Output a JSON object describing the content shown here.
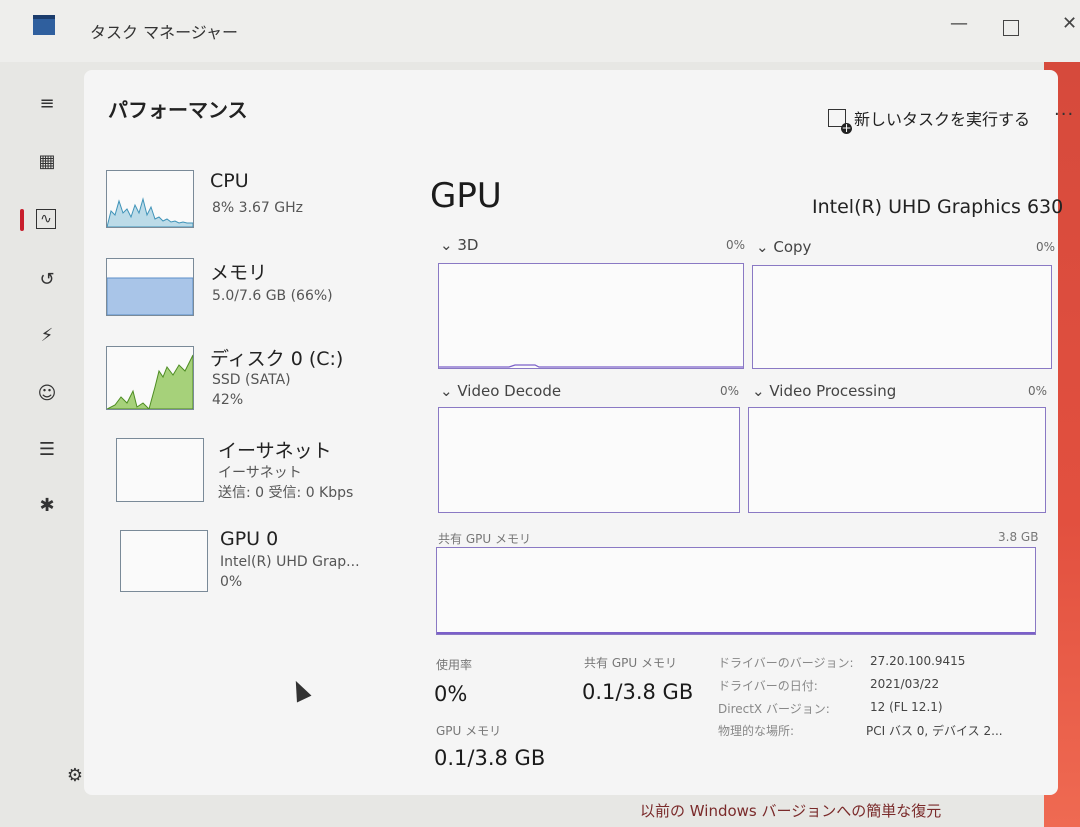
{
  "window": {
    "title": "タスク マネージャー",
    "min": "—",
    "close": "✕"
  },
  "nav": {
    "menu_icon": "≡",
    "items": [
      {
        "name": "processes",
        "icon": "▦"
      },
      {
        "name": "performance",
        "icon": "∿"
      },
      {
        "name": "app-history",
        "icon": "↺"
      },
      {
        "name": "startup-apps",
        "icon": "⚡"
      },
      {
        "name": "users",
        "icon": "☺"
      },
      {
        "name": "details",
        "icon": "☰"
      },
      {
        "name": "services",
        "icon": "✱"
      }
    ],
    "settings_icon": "⚙"
  },
  "header": {
    "title": "パフォーマンス",
    "run_task": "新しいタスクを実行する",
    "more": "···"
  },
  "devices": [
    {
      "name": "CPU",
      "sub1": "8%  3.67 GHz",
      "sub2": "",
      "color": "#3f93b8"
    },
    {
      "name": "メモリ",
      "sub1": "5.0/7.6 GB (66%)",
      "sub2": "",
      "memory_fraction": 0.66,
      "color": "#5c8ec9"
    },
    {
      "name": "ディスク 0 (C:)",
      "sub1": "SSD (SATA)",
      "sub2": "42%",
      "color": "#6fb43a"
    },
    {
      "name": "イーサネット",
      "sub1": "イーサネット",
      "sub2": "送信: 0  受信: 0 Kbps",
      "color": "#a36fb0"
    },
    {
      "name": "GPU 0",
      "sub1": "Intel(R) UHD Grap...",
      "sub2": "0%",
      "color": "#7b5fc9"
    }
  ],
  "gpu": {
    "title": "GPU",
    "model": "Intel(R) UHD Graphics 630",
    "graphs": [
      {
        "label": "3D",
        "pct": "0%"
      },
      {
        "label": "Copy",
        "pct": "0%"
      },
      {
        "label": "Video Decode",
        "pct": "0%"
      },
      {
        "label": "Video Processing",
        "pct": "0%"
      }
    ],
    "shared_mem_label": "共有 GPU メモリ",
    "shared_mem_max": "3.8 GB",
    "stats": {
      "usage_label": "使用率",
      "usage_value": "0%",
      "shared_label": "共有 GPU メモリ",
      "shared_value": "0.1/3.8 GB",
      "gpumem_label": "GPU メモリ",
      "gpumem_value": "0.1/3.8 GB"
    },
    "info": [
      {
        "label": "ドライバーのバージョン:",
        "value": "27.20.100.9415"
      },
      {
        "label": "ドライバーの日付:",
        "value": "2021/03/22"
      },
      {
        "label": "DirectX バージョン:",
        "value": "12 (FL 12.1)"
      },
      {
        "label": "物理的な場所:",
        "value": "PCI バス 0, デバイス 2..."
      }
    ]
  },
  "bottom_text": "以前の Windows バージョンへの簡単な復元"
}
